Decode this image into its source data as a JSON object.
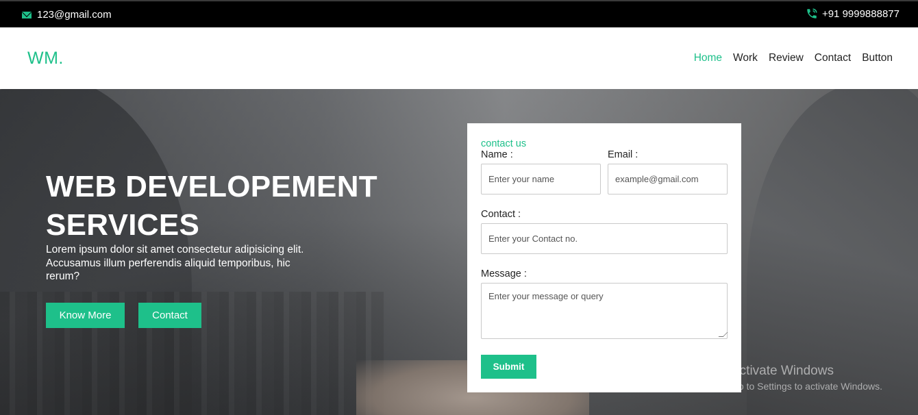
{
  "topbar": {
    "email": "123@gmail.com",
    "email_icon": "mail-icon",
    "phone": "+91 9999888877",
    "phone_icon": "phone-icon"
  },
  "nav": {
    "logo": "WM.",
    "items": [
      {
        "label": "Home",
        "active": true
      },
      {
        "label": "Work",
        "active": false
      },
      {
        "label": "Review",
        "active": false
      },
      {
        "label": "Contact",
        "active": false
      },
      {
        "label": "Button",
        "active": false
      }
    ]
  },
  "hero": {
    "headline_line1": "WEB DEVELOPEMENT",
    "headline_line2": "SERVICES",
    "lead": "Lorem ipsum dolor sit amet consectetur adipisicing elit. Accusamus illum perferendis aliquid temporibus, hic rerum?",
    "know_more_label": "Know More",
    "contact_label": "Contact"
  },
  "form": {
    "title": "contact us",
    "name_label": "Name :",
    "name_placeholder": "Enter your name",
    "email_label": "Email :",
    "email_placeholder": "example@gmail.com",
    "contact_label": "Contact :",
    "contact_placeholder": "Enter your Contact no.",
    "message_label": "Message :",
    "message_placeholder": "Enter your message or query",
    "submit_label": "Submit"
  },
  "watermark": {
    "line1": "Activate Windows",
    "line2": "Go to Settings to activate Windows."
  },
  "colors": {
    "accent": "#1ec08a",
    "topbar_bg": "#000000"
  }
}
